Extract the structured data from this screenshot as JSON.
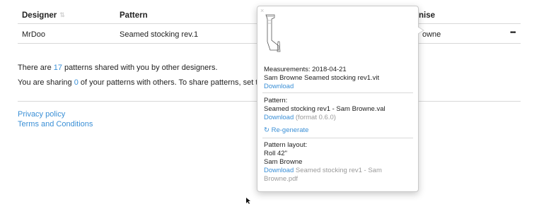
{
  "table": {
    "headers": {
      "designer": "Designer",
      "pattern": "Pattern",
      "license_partial": "nise"
    },
    "rows": [
      {
        "designer": "MrDoo",
        "pattern": "Seamed stocking rev.1",
        "license_link_partial": "owne",
        "menu": "•••"
      }
    ]
  },
  "info": {
    "shared_prefix": "There are ",
    "shared_count": "17",
    "shared_suffix": " patterns shared with you by other designers.",
    "sharing_prefix": "You are sharing ",
    "sharing_count": "0",
    "sharing_suffix": " of your patterns with others. To share patterns, set the shari"
  },
  "footer": {
    "privacy": "Privacy policy",
    "terms": "Terms and Conditions"
  },
  "popover": {
    "close": "×",
    "measurements": {
      "label": "Measurements: 2018-04-21",
      "file": "Sam Browne Seamed stocking rev1.vit",
      "download": "Download"
    },
    "pattern": {
      "label": "Pattern:",
      "file": "Seamed stocking rev1 - Sam Browne.val",
      "download": "Download",
      "format": " (format 0.6.0)",
      "regenerate": "Re-generate"
    },
    "layout": {
      "label": "Pattern layout:",
      "roll": "Roll 42\"",
      "author": "Sam Browne",
      "download": "Download",
      "file": " Seamed stocking rev1 - Sam Browne.pdf"
    }
  }
}
